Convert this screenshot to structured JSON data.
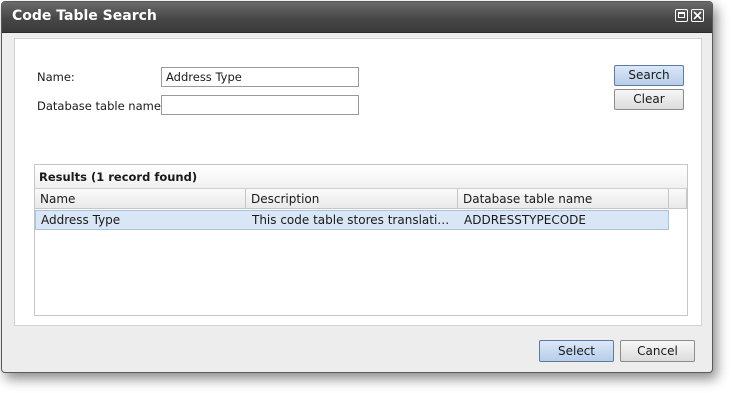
{
  "window": {
    "title": "Code Table Search"
  },
  "form": {
    "name_label": "Name:",
    "name_value": "Address Type",
    "db_label": "Database table name:",
    "db_value": ""
  },
  "buttons": {
    "search": "Search",
    "clear": "Clear",
    "select": "Select",
    "cancel": "Cancel"
  },
  "results": {
    "title": "Results (1 record found)",
    "columns": [
      "Name",
      "Description",
      "Database table name"
    ],
    "rows": [
      {
        "name": "Address Type",
        "description": "This code table stores translations o...",
        "db_table": "ADDRESSTYPECODE"
      }
    ]
  },
  "colors": {
    "titlebar": "#474747",
    "selected_row": "#d8e6f6",
    "primary_button": "#b7cde9"
  },
  "icons": [
    "maximize-icon",
    "close-icon"
  ]
}
